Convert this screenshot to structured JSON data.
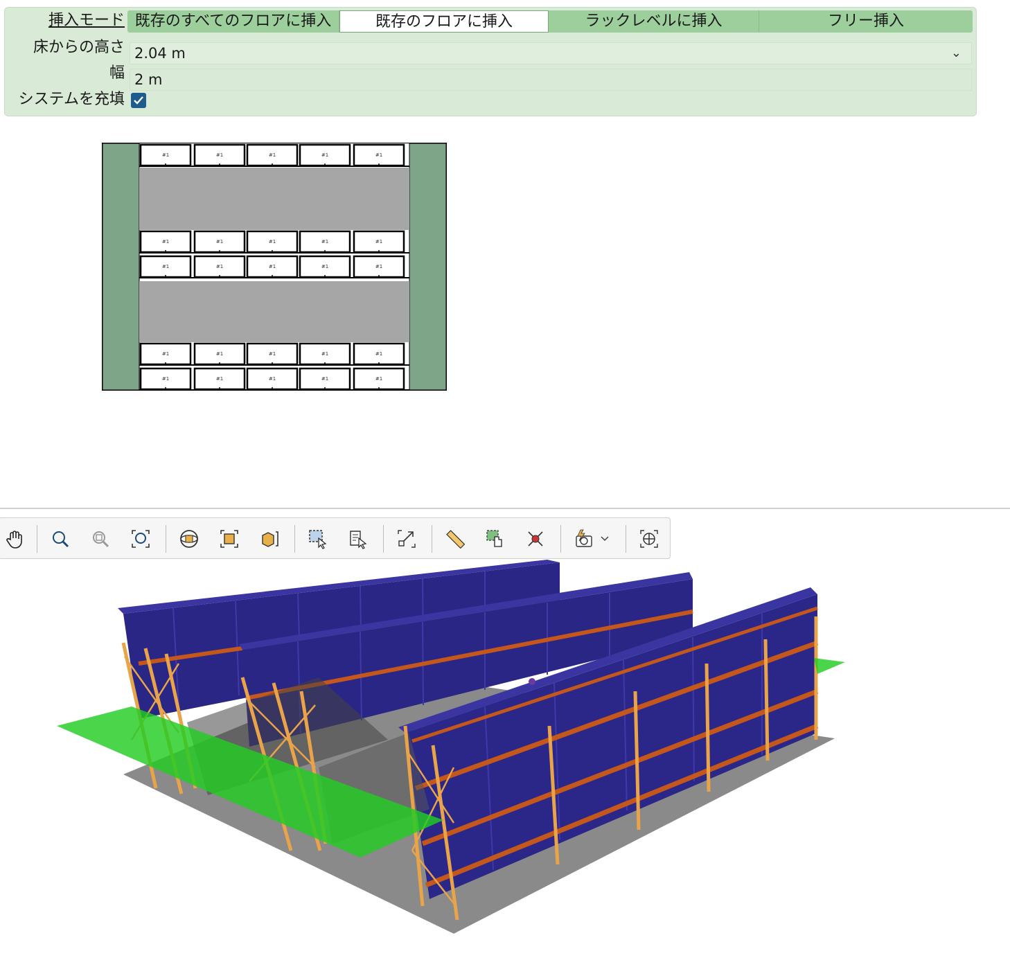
{
  "properties": {
    "insert_mode": {
      "label": "挿入モード",
      "options": [
        "既存のすべてのフロアに挿入",
        "既存のフロアに挿入",
        "ラックレベルに挿入",
        "フリー挿入"
      ],
      "selected": "既存のフロアに挿入"
    },
    "height_from_floor": {
      "label": "床からの高さ",
      "value": "2.04 m"
    },
    "width": {
      "label": "幅",
      "value": "2 m"
    },
    "fill_system": {
      "label": "システムを充填",
      "checked": true
    }
  },
  "plan_view": {
    "cell_label": "#1",
    "colors": {
      "column": "#7ea587",
      "aisle": "#a6a6a6",
      "rack": "#ffffff",
      "outline": "#000000"
    }
  },
  "toolbar": {
    "tools": [
      "pan-icon",
      "zoom-icon",
      "zoom-out-icon",
      "zoom-fit-icon",
      "view-sphere-icon",
      "view-front-icon",
      "view-box-icon",
      "select-area-icon",
      "select-list-icon",
      "resize-icon",
      "measure-icon",
      "move-icon",
      "delete-icon",
      "capture-icon",
      "dropdown-chevron-icon",
      "center-icon"
    ]
  },
  "scene_colors": {
    "box": "#2e2a8f",
    "upright": "#e9a44a",
    "beam": "#c4571b",
    "floor": "#8a8a8a",
    "plane": "#27cc27"
  }
}
